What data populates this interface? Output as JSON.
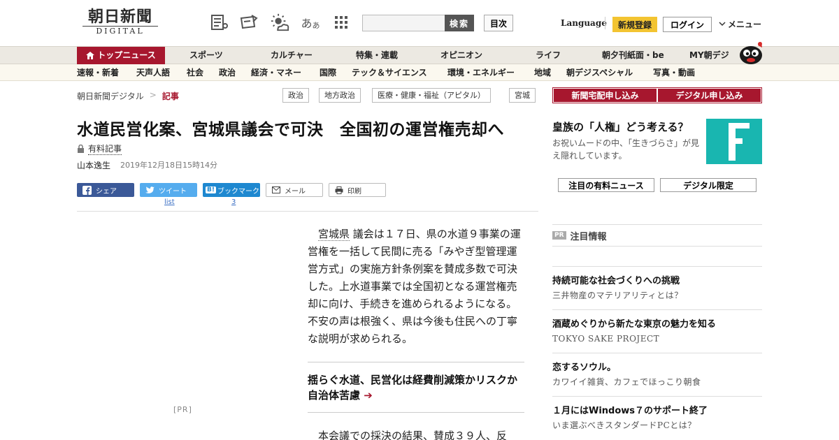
{
  "header": {
    "logo_jp": "朝日新聞",
    "logo_en": "DIGITAL",
    "kana_glyph_big": "あ",
    "kana_glyph_small": "あ",
    "search_placeholder": "",
    "search_label": "検索",
    "toc_label": "目次",
    "language_label": "Language",
    "register_label": "新規登録",
    "login_label": "ログイン",
    "menu_label": "メニュー",
    "colors": {
      "brand_red": "#a7172e",
      "register_yellow": "#f3c431"
    }
  },
  "nav_primary": {
    "items": [
      "トップニュース",
      "スポーツ",
      "カルチャー",
      "特集・連載",
      "オピニオン",
      "ライフ",
      "朝夕刊紙面・be",
      "MY朝デジ"
    ]
  },
  "nav_secondary": {
    "items": [
      "速報・新着",
      "天声人語",
      "社会",
      "政治",
      "経済・マネー",
      "国際",
      "テック＆サイエンス",
      "環境・エネルギー",
      "地域",
      "朝デジスペシャル",
      "写真・動画"
    ]
  },
  "breadcrumb": {
    "home": "朝日新聞デジタル",
    "sep": ">",
    "current": "記事"
  },
  "tags": [
    "政治",
    "地方政治",
    "医療・健康・福祉（アピタル）",
    "宮城"
  ],
  "article": {
    "title": "水道民営化案、宮城県議会で可決　全国初の運営権売却へ",
    "paid_label": "有料記事",
    "author": "山本逸生",
    "date": "2019年12月18日15時14分",
    "body_place": "宮城県",
    "body_rest": "議会は１７日、県の水道９事業の運営権を一括して民間に売る「みやぎ型管理運営方式」の実施方針条例案を賛成多数で可決した。上水道事業では全国初となる運営権売却に向け、手続きを進められるようになる。不安の声は根強く、県は今後も住民への丁寧な説明が求められる。",
    "related_title": "揺らぐ水道、民営化は経費削減策かリスクか　自治体苦慮",
    "related_arrow": "➔",
    "body_2": "本会議での採決の結果、賛成３９人、反"
  },
  "share": {
    "facebook": "シェア",
    "twitter": "ツイート",
    "hatena": "ブックマーク",
    "mail": "メール",
    "print": "印刷",
    "twitter_count": "list",
    "hatena_count": "3"
  },
  "ad": {
    "pr_label": "[PR]"
  },
  "sidebar": {
    "subscribe_home": "新聞宅配申し込み",
    "subscribe_digital": "デジタル申し込み",
    "promo_title": "皇族の「人権」どう考える？",
    "promo_desc": "お祝いムードの中、「生きづらさ」が見え隠れしています。",
    "tab_paid": "注目の有料ニュース",
    "tab_digital": "デジタル限定",
    "pr_tag": "PR",
    "pr_header": "注目情報",
    "pr_items": [
      {
        "title": "持続可能な社会づくりへの挑戦",
        "sub": "三井物産のマテリアリティとは？"
      },
      {
        "title": "酒蔵めぐりから新たな東京の魅力を知る",
        "sub": "TOKYO SAKE PROJECT"
      },
      {
        "title": "恋するソウル。",
        "sub": "カワイイ雑貨、カフェでほっこり朝食"
      },
      {
        "title": "１月にはWindows７のサポート終了",
        "sub": "いま選ぶべきスタンダードPCとは？"
      }
    ]
  }
}
